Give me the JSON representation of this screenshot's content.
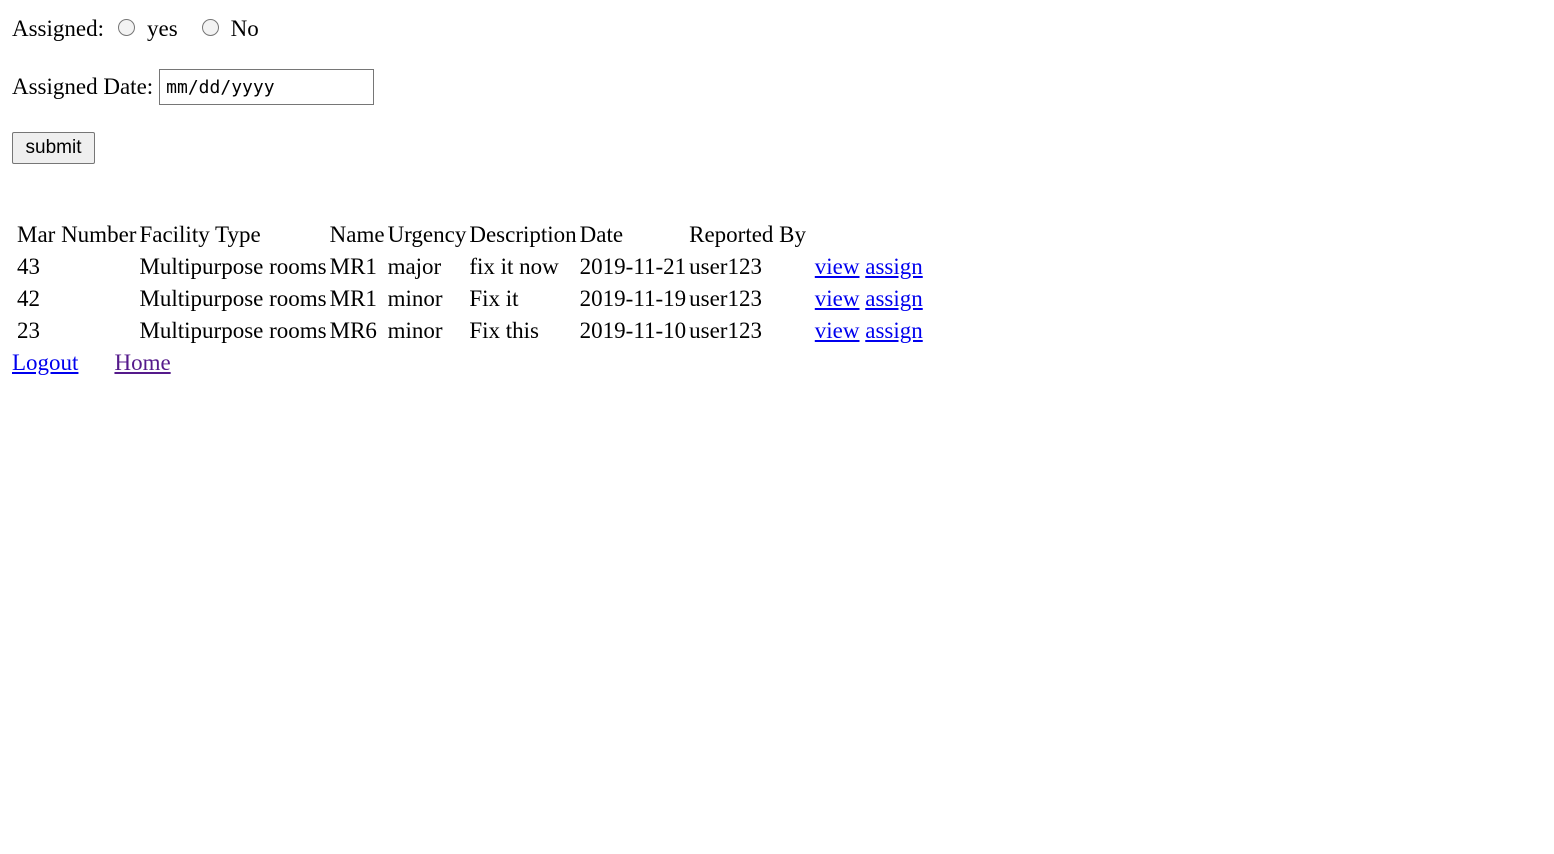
{
  "filters": {
    "assigned_label": "Assigned:",
    "yes_label": "yes",
    "no_label": "No",
    "assigned_date_label": "Assigned Date:",
    "assigned_date_placeholder": "mm/dd/yyyy",
    "submit_label": "submit"
  },
  "table": {
    "headers": [
      "Mar Number",
      "Facility Type",
      "Name",
      "Urgency",
      "Description",
      "Date",
      "Reported By"
    ],
    "rows": [
      {
        "mar_number": "43",
        "facility_type": "Multipurpose rooms",
        "name": "MR1",
        "urgency": "major",
        "description": "fix it now",
        "date": "2019-11-21",
        "reported_by": "user123",
        "view": "view",
        "assign": "assign"
      },
      {
        "mar_number": "42",
        "facility_type": "Multipurpose rooms",
        "name": "MR1",
        "urgency": "minor",
        "description": "Fix it",
        "date": "2019-11-19",
        "reported_by": "user123",
        "view": "view",
        "assign": "assign"
      },
      {
        "mar_number": "23",
        "facility_type": "Multipurpose rooms",
        "name": "MR6",
        "urgency": "minor",
        "description": "Fix this",
        "date": "2019-11-10",
        "reported_by": "user123",
        "view": "view",
        "assign": "assign"
      }
    ]
  },
  "footer": {
    "logout_label": "Logout",
    "home_label": "Home"
  },
  "colors": {
    "link": "#0000ee",
    "visited_link": "#551a8b"
  }
}
